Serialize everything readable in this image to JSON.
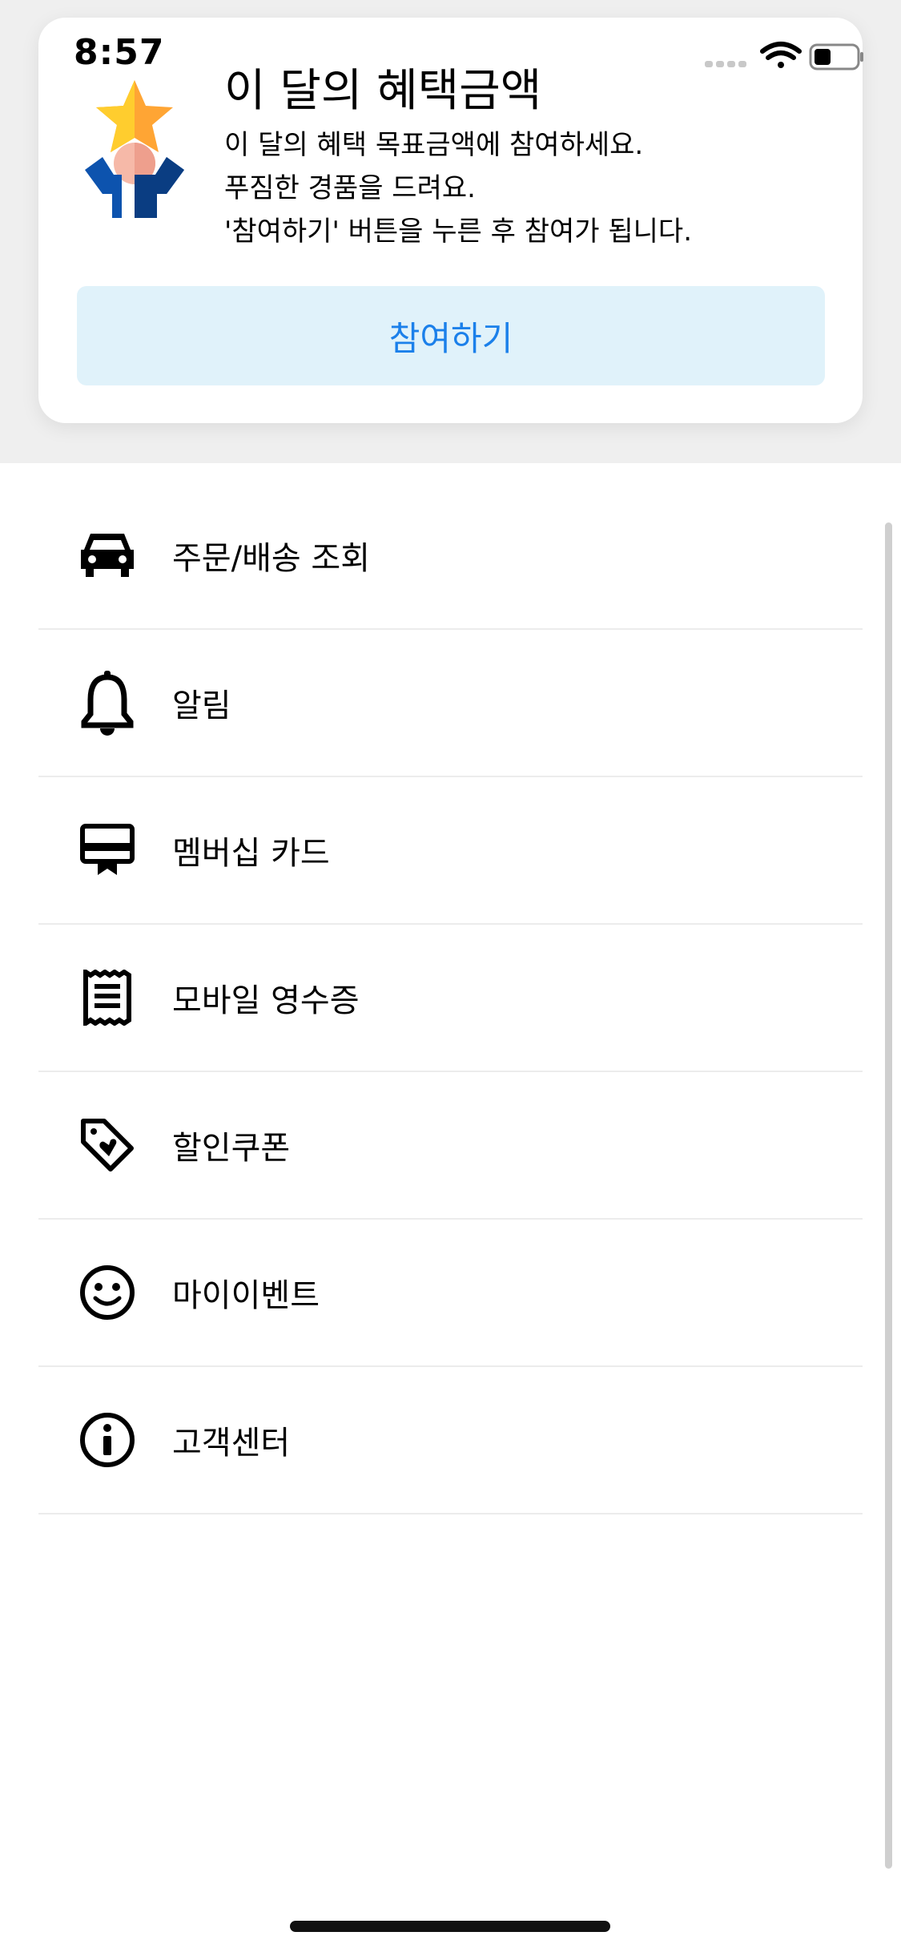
{
  "status_bar": {
    "time": "8:57"
  },
  "promo": {
    "title": "이 달의 혜택금액",
    "lines": [
      "이 달의 혜택 목표금액에 참여하세요.",
      "푸짐한 경품을 드려요.",
      "'참여하기' 버튼을 누른 후 참여가 됩니다."
    ],
    "button_label": "참여하기",
    "button_color": "#1b80ea",
    "button_bg": "#e0f2fa"
  },
  "menu": {
    "items": [
      {
        "icon": "car-icon",
        "label": "주문/배송 조회"
      },
      {
        "icon": "bell-icon",
        "label": "알림"
      },
      {
        "icon": "membership-card-icon",
        "label": "멤버십 카드"
      },
      {
        "icon": "receipt-icon",
        "label": "모바일 영수증"
      },
      {
        "icon": "tag-heart-icon",
        "label": "할인쿠폰"
      },
      {
        "icon": "smile-icon",
        "label": "마이이벤트"
      },
      {
        "icon": "info-icon",
        "label": "고객센터"
      }
    ]
  }
}
